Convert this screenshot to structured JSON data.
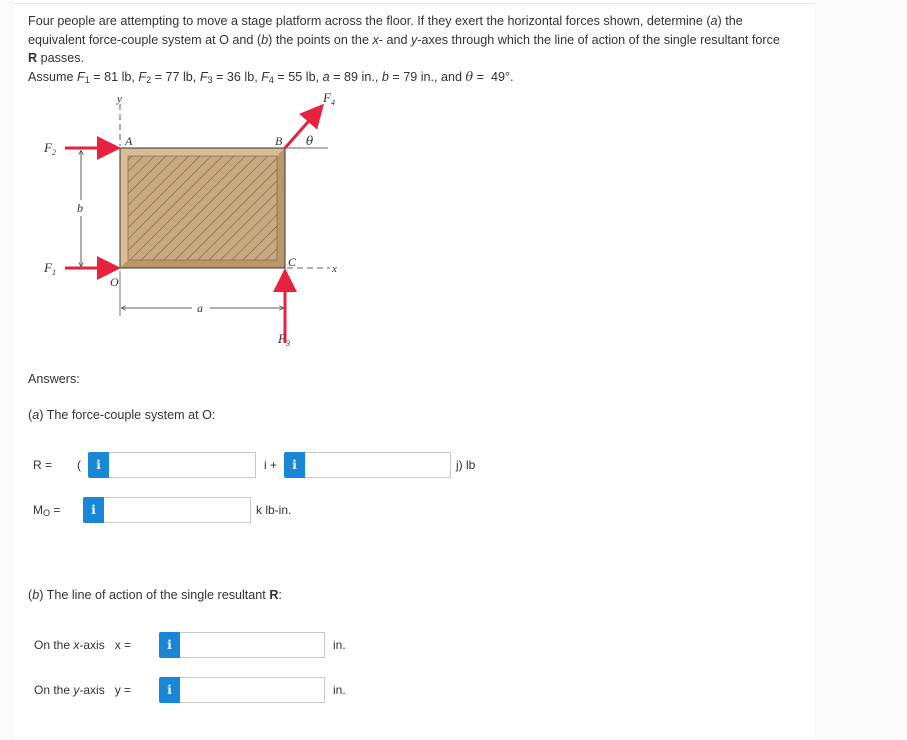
{
  "problem": {
    "line1": "Four people are attempting to move a stage platform across the floor. If they exert the horizontal forces shown, determine (a) the",
    "line2": "equivalent force-couple system at O and (b) the points on the x- and y-axes through which the line of action of the single resultant force",
    "line3_bold": "R",
    "line3_rest": " passes.",
    "assume_prefix": "Assume ",
    "F1": "81",
    "F2": "77",
    "F3": "36",
    "F4": "55",
    "a": "89",
    "b": "79",
    "theta": "49",
    "force_unit": "lb",
    "length_unit": "in.",
    "angle_unit": "°."
  },
  "figure": {
    "labels": {
      "y": "y",
      "x": "x",
      "A": "A",
      "B": "B",
      "C": "C",
      "O": "O",
      "a": "a",
      "b": "b",
      "theta": "θ",
      "F1": "F",
      "F2": "F",
      "F3": "F",
      "F4": "F",
      "F1_sub": "1",
      "F2_sub": "2",
      "F3_sub": "3",
      "F4_sub": "4"
    },
    "colors": {
      "force": "#e8213f",
      "wood": "#c9aa80",
      "wood_edge": "#a8875e",
      "outline": "#333333"
    }
  },
  "answers": {
    "heading": "Answers:",
    "part_a": "(a) The force-couple system at O:",
    "R_label": "R =",
    "R_open": "(",
    "R_i": "i +",
    "R_j": "j) lb",
    "R_x_value": "",
    "R_y_value": "",
    "Mo_label": "M",
    "Mo_sub": "O",
    "Mo_eq": " =",
    "Mo_value": "",
    "Mo_unit": "k lb-in.",
    "part_b": "(b) The line of action of the single resultant R:",
    "x_label": "On the x-axis   x =",
    "x_value": "",
    "x_unit": "in.",
    "y_label": "On the y-axis   y =",
    "y_value": "",
    "y_unit": "in.",
    "info_glyph": "i"
  },
  "colors": {
    "info_button": "#1a87d6",
    "page_bg": "#fafafa",
    "card_bg": "#ffffff"
  }
}
